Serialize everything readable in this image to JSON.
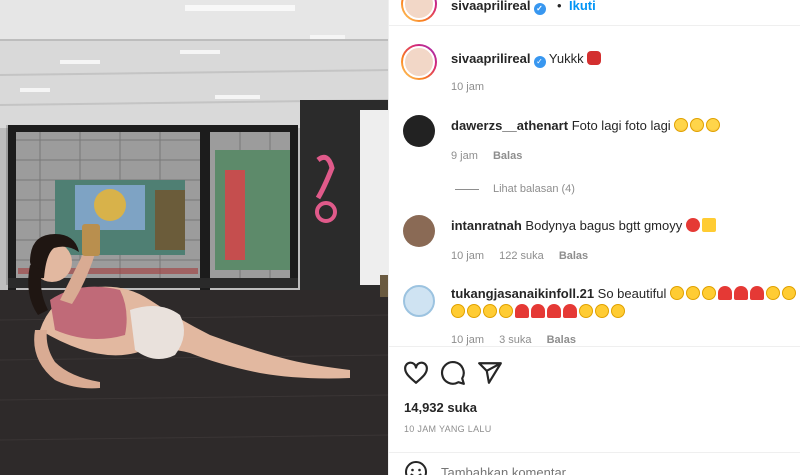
{
  "post": {
    "username": "sivaaprilireal",
    "separator": "•",
    "follow_label": "Ikuti",
    "caption_text": "Yukkk",
    "caption_time": "10 jam",
    "likes": "14,932 suka",
    "time_ago": "10 JAM YANG LALU",
    "add_comment_placeholder": "Tambahkan komentar..."
  },
  "comments": [
    {
      "username": "dawerzs__athenart",
      "text": "Foto lagi foto lagi",
      "time": "9 jam",
      "reply_label": "Balas",
      "view_replies": "Lihat balasan (4)"
    },
    {
      "username": "intanratnah",
      "text": "Bodynya bagus bgtt gmoyy",
      "time": "10 jam",
      "likes": "122 suka",
      "reply_label": "Balas"
    },
    {
      "username": "tukangjasanaikinfoll.21",
      "text": "So beautiful",
      "time": "10 jam",
      "likes": "3 suka",
      "reply_label": "Balas"
    }
  ],
  "icons": {
    "like": "heart-icon",
    "comment": "comment-icon",
    "share": "share-icon",
    "verified": "verified-badge-icon",
    "emoji": "smile-icon"
  },
  "colors": {
    "link": "#0095f6",
    "verified": "#3897f0",
    "muted": "#8e8e8e",
    "text": "#262626"
  }
}
